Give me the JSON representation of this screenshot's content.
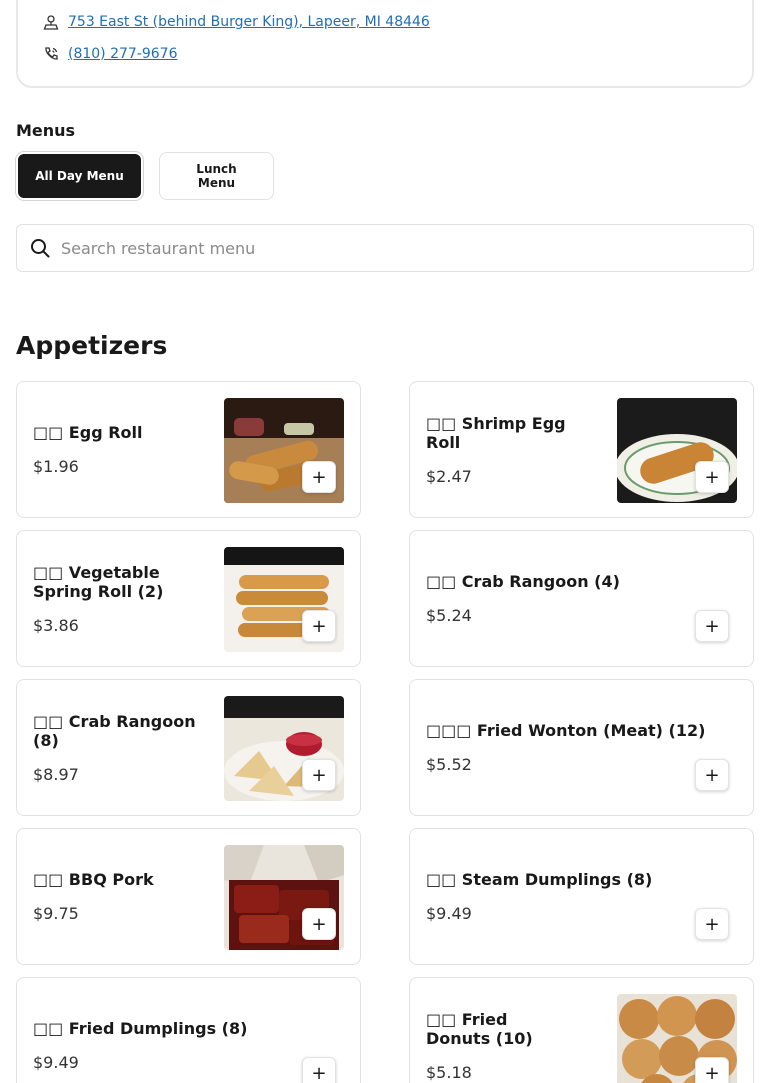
{
  "info": {
    "address": "753 East St (behind Burger King), Lapeer, MI 48446",
    "phone": "(810) 277-9676"
  },
  "menus": {
    "title": "Menus",
    "tabs": [
      {
        "label": "All Day Menu",
        "active": true
      },
      {
        "label": "Lunch Menu",
        "active": false
      }
    ]
  },
  "search": {
    "placeholder": "Search restaurant menu",
    "value": ""
  },
  "section": {
    "title": "Appetizers"
  },
  "items": [
    {
      "name": "□□ Egg Roll",
      "price": "$1.96",
      "has_image": true
    },
    {
      "name": "□□ Shrimp Egg Roll",
      "price": "$2.47",
      "has_image": true
    },
    {
      "name": "□□ Vegetable Spring Roll (2)",
      "price": "$3.86",
      "has_image": true
    },
    {
      "name": "□□ Crab Rangoon (4)",
      "price": "$5.24",
      "has_image": false
    },
    {
      "name": "□□ Crab Rangoon (8)",
      "price": "$8.97",
      "has_image": true
    },
    {
      "name": "□□□ Fried Wonton (Meat) (12)",
      "price": "$5.52",
      "has_image": false
    },
    {
      "name": "□□ BBQ Pork",
      "price": "$9.75",
      "has_image": true
    },
    {
      "name": "□□ Steam Dumplings (8)",
      "price": "$9.49",
      "has_image": false
    },
    {
      "name": "□□ Fried Dumplings (8)",
      "price": "$9.49",
      "has_image": false
    },
    {
      "name": "□□ Fried Donuts (10)",
      "price": "$5.18",
      "has_image": true
    }
  ],
  "add_label": "+",
  "colors": {
    "accent": "#191919",
    "link": "#1f6fb5",
    "border": "#e2e2e2"
  },
  "icons": {
    "address": "map-pin-icon",
    "phone": "phone-icon",
    "search": "search-icon",
    "add": "plus-icon"
  }
}
